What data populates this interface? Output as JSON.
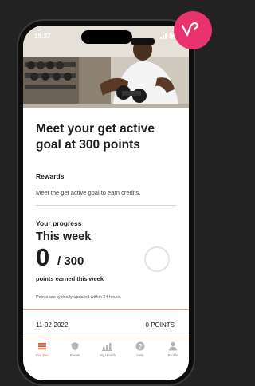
{
  "status_bar": {
    "time": "15:27"
  },
  "goal": {
    "title": "Meet your get active goal at 300 points"
  },
  "rewards": {
    "heading": "Rewards",
    "text": "Meet the get active goal to earn credits."
  },
  "progress": {
    "heading": "Your progress",
    "period": "This week",
    "points": "0",
    "total": "/ 300",
    "points_fraction": 0,
    "caption": "points earned this week",
    "note": "Points are typically updated within 24 hours."
  },
  "history": [
    {
      "date": "11-02-2022",
      "points": "0 POINTS"
    }
  ],
  "tabs": [
    {
      "label": "For You",
      "icon": "menu-icon",
      "active": true
    },
    {
      "label": "Points",
      "icon": "shield-icon",
      "active": false
    },
    {
      "label": "My Health",
      "icon": "chart-icon",
      "active": false
    },
    {
      "label": "Help",
      "icon": "help-icon",
      "active": false
    },
    {
      "label": "Profile",
      "icon": "profile-icon",
      "active": false
    }
  ],
  "colors": {
    "accent": "#e0592a",
    "badge": "#e8336f"
  }
}
